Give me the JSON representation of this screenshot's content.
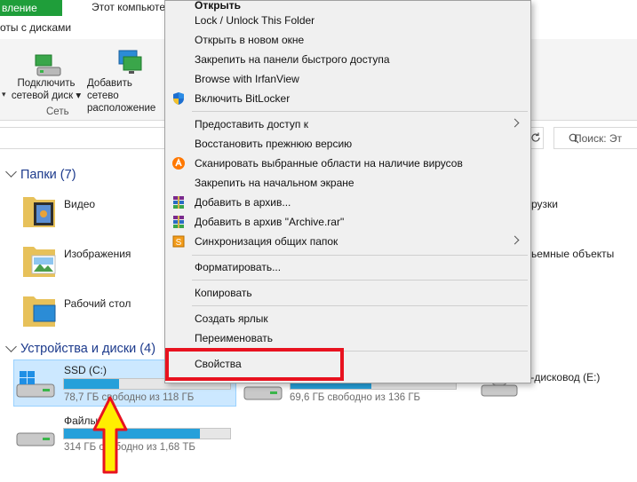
{
  "ribbon": {
    "tab_share_partial": "вление",
    "tab_computer": "Этот компьютер",
    "subtab_disks": "оты с дисками",
    "btn_network_drive": [
      "Подключить",
      "сетевой диск"
    ],
    "btn_network_location": [
      "Добавить сетево",
      "расположение"
    ],
    "group_network": "Сеть"
  },
  "search": {
    "placeholder": "Поиск: Эт"
  },
  "sections": {
    "folders_title": "Папки (7)",
    "devices_title": "Устройства и диски (4)"
  },
  "folders": [
    {
      "label": "Видео"
    },
    {
      "label": "Изображения"
    },
    {
      "label": "Рабочий стол"
    }
  ],
  "folders_right_partial": [
    {
      "label": "рузки"
    },
    {
      "label": "ьемные объекты"
    }
  ],
  "drives": [
    {
      "name": "SSD (C:)",
      "free": "78,7 ГБ свободно из 118 ГБ",
      "fill": 0.33
    },
    {
      "name": "",
      "free": "69,6 ГБ свободно из 136 ГБ",
      "fill": 0.49
    },
    {
      "name": "CD-дисковод (E:)",
      "free": ""
    },
    {
      "name": "Файлы",
      "free": "314 ГБ свободно из 1,68 ТБ",
      "fill": 0.82
    }
  ],
  "context_menu": {
    "items": [
      {
        "label": "Открыть",
        "icon": ""
      },
      {
        "label": "Lock / Unlock This Folder",
        "icon": ""
      },
      {
        "label": "Открыть в новом окне",
        "icon": ""
      },
      {
        "label": "Закрепить на панели быстрого доступа",
        "icon": ""
      },
      {
        "label": "Browse with IrfanView",
        "icon": ""
      },
      {
        "label": "Включить BitLocker",
        "icon": "shield-icon"
      },
      {
        "label": "Предоставить доступ к",
        "icon": "",
        "submenu": true
      },
      {
        "label": "Восстановить прежнюю версию",
        "icon": ""
      },
      {
        "label": "Сканировать выбранные области на наличие вирусов",
        "icon": "avast-icon"
      },
      {
        "label": "Закрепить на начальном экране",
        "icon": ""
      },
      {
        "label": "Добавить в архив...",
        "icon": "winrar-icon"
      },
      {
        "label": "Добавить в архив \"Archive.rar\"",
        "icon": "winrar-icon"
      },
      {
        "label": "Синхронизация общих папок",
        "icon": "sync-icon",
        "submenu": true
      },
      {
        "label": "Форматировать...",
        "icon": ""
      },
      {
        "label": "Копировать",
        "icon": ""
      },
      {
        "label": "Создать ярлык",
        "icon": ""
      },
      {
        "label": "Переименовать",
        "icon": ""
      },
      {
        "label": "Свойства",
        "icon": ""
      }
    ]
  },
  "colors": {
    "accent": "#26a0da",
    "highlight": "#e8121f",
    "arrow": "#ffee00",
    "selection": "#cce8ff"
  }
}
